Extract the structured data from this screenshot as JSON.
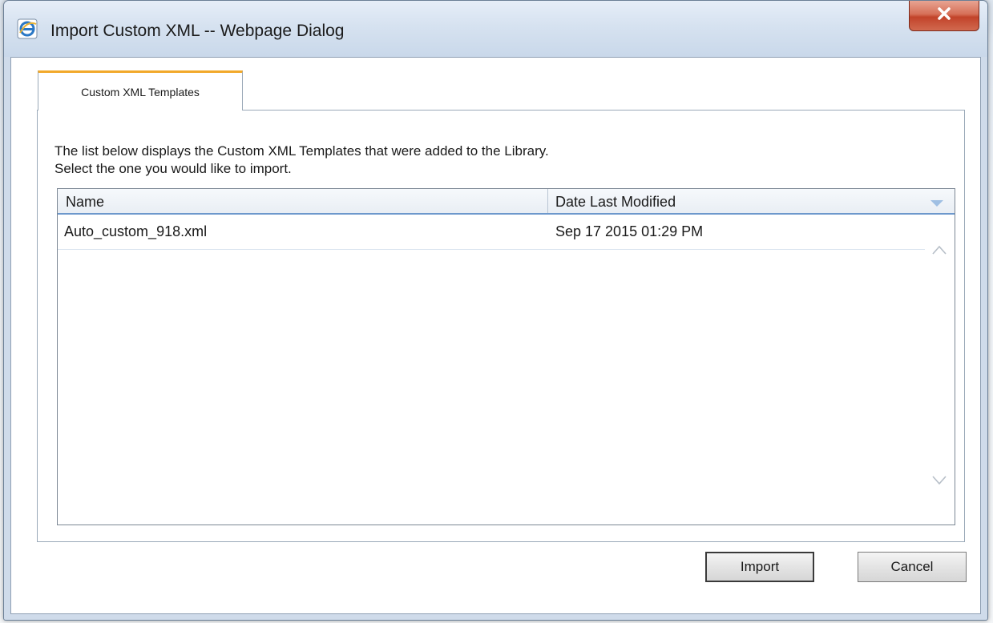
{
  "window": {
    "title": "Import Custom XML -- Webpage Dialog"
  },
  "tabs": [
    {
      "label": "Custom XML Templates",
      "active": true
    }
  ],
  "description": {
    "line1": "The list below displays the Custom XML Templates that were added to the Library.",
    "line2": "Select the one you would like to import."
  },
  "grid": {
    "columns": [
      "Name",
      "Date Last Modified"
    ],
    "rows": [
      {
        "name": "Auto_custom_918.xml",
        "date": "Sep 17 2015 01:29 PM"
      }
    ]
  },
  "buttons": {
    "import": "Import",
    "cancel": "Cancel"
  },
  "icons": {
    "window_icon": "internet-explorer-icon",
    "close": "close-icon",
    "sort": "sort-descending-icon",
    "scroll_up": "chevron-up-icon",
    "scroll_down": "chevron-down-icon"
  },
  "colors": {
    "tab_accent": "#f2a92b",
    "header_underline": "#6d98cc",
    "close_button": "#c2432a"
  }
}
